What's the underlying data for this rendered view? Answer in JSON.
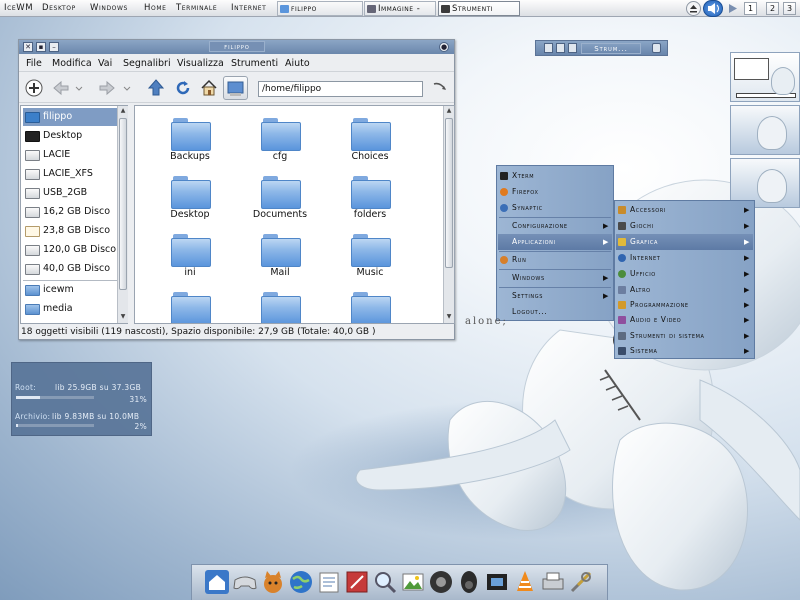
{
  "taskbar": {
    "menu_items": [
      "IceWM",
      "Desktop",
      "Windows",
      "Home",
      "Terminale",
      "Internet"
    ],
    "tasks": [
      {
        "label": "filippo",
        "active": false
      },
      {
        "label": "Immagine -",
        "active": false
      },
      {
        "label": "Strumenti",
        "active": true
      }
    ],
    "workspaces": [
      "1",
      "2",
      "3"
    ]
  },
  "file_manager": {
    "title": "filippo",
    "menubar": [
      "File",
      "Modifica",
      "Vai",
      "Segnalibri",
      "Visualizza",
      "Strumenti",
      "Aiuto"
    ],
    "location": "/home/filippo",
    "sidebar": [
      {
        "label": "filippo",
        "icon": "home-icon",
        "selected": true
      },
      {
        "label": "Desktop",
        "icon": "monitor-icon"
      },
      {
        "label": "LACIE",
        "icon": "drive-icon"
      },
      {
        "label": "LACIE_XFS",
        "icon": "drive-icon"
      },
      {
        "label": "USB_2GB",
        "icon": "drive-icon"
      },
      {
        "label": "16,2 GB Disco",
        "icon": "drive-icon"
      },
      {
        "label": "23,8 GB Disco",
        "icon": "document-icon"
      },
      {
        "label": "120,0 GB Disco",
        "icon": "drive-icon"
      },
      {
        "label": "40,0 GB Disco",
        "icon": "drive-icon"
      },
      {
        "label": "icewm",
        "icon": "folder-icon"
      },
      {
        "label": "media",
        "icon": "folder-icon"
      }
    ],
    "files": [
      "Backups",
      "cfg",
      "Choices",
      "Desktop",
      "Documents",
      "folders",
      "ini",
      "Mail",
      "Music",
      "",
      "",
      ""
    ],
    "status": "18 oggetti visibili (119 nascosti), Spazio disponibile: 27,9 GB (Totale: 40,0 GB )"
  },
  "mini_panel": {
    "label": "Strum..."
  },
  "disk_monitor": {
    "root_label": "Root:",
    "root_text": "lib 25.9GB su 37.3GB",
    "root_percent": "31%",
    "root_fraction": 0.31,
    "archive_label": "Archivio:",
    "archive_text": "lib 9.83MB su 10.0MB",
    "archive_percent": "2%",
    "archive_fraction": 0.02
  },
  "main_menu": [
    {
      "label": "Xterm",
      "icon": "terminal-icon"
    },
    {
      "label": "Firefox",
      "icon": "firefox-icon"
    },
    {
      "label": "Synaptic",
      "icon": "synaptic-icon"
    },
    {
      "label": "Configurazione",
      "submenu": true
    },
    {
      "label": "Applicazioni",
      "submenu": true,
      "selected": true
    },
    {
      "label": "Run",
      "icon": "run-icon"
    },
    {
      "label": "Windows",
      "submenu": true
    },
    {
      "label": "Settings",
      "submenu": true
    },
    {
      "label": "Logout..."
    }
  ],
  "applications_menu": [
    {
      "label": "Accessori",
      "icon": "accessories-icon"
    },
    {
      "label": "Giochi",
      "icon": "games-icon"
    },
    {
      "label": "Grafica",
      "icon": "graphics-icon",
      "selected": true
    },
    {
      "label": "Internet",
      "icon": "internet-icon"
    },
    {
      "label": "Ufficio",
      "icon": "office-icon"
    },
    {
      "label": "Altro",
      "icon": "other-icon"
    },
    {
      "label": "Programmazione",
      "icon": "programming-icon"
    },
    {
      "label": "Audio e Video",
      "icon": "multimedia-icon"
    },
    {
      "label": "Strumenti di sistema",
      "icon": "system-tools-icon"
    },
    {
      "label": "Sistema",
      "icon": "system-icon"
    }
  ],
  "wallpaper_text": "alone;",
  "dock_icons": [
    "home-icon",
    "gamepad-icon",
    "cat-icon",
    "globe-icon",
    "notes-icon",
    "graphics-icon",
    "search-icon",
    "image-viewer-icon",
    "media-player-icon",
    "speaker-icon",
    "film-icon",
    "vlc-cone-icon",
    "printer-icon",
    "tools-icon"
  ],
  "colors": {
    "titlebar": "#7690b4",
    "menu_bg": "#94aecf",
    "menu_selected": "#5d7aa5",
    "disk_monitor_bg": "#587498",
    "folder_blue": "#5a95dc"
  }
}
